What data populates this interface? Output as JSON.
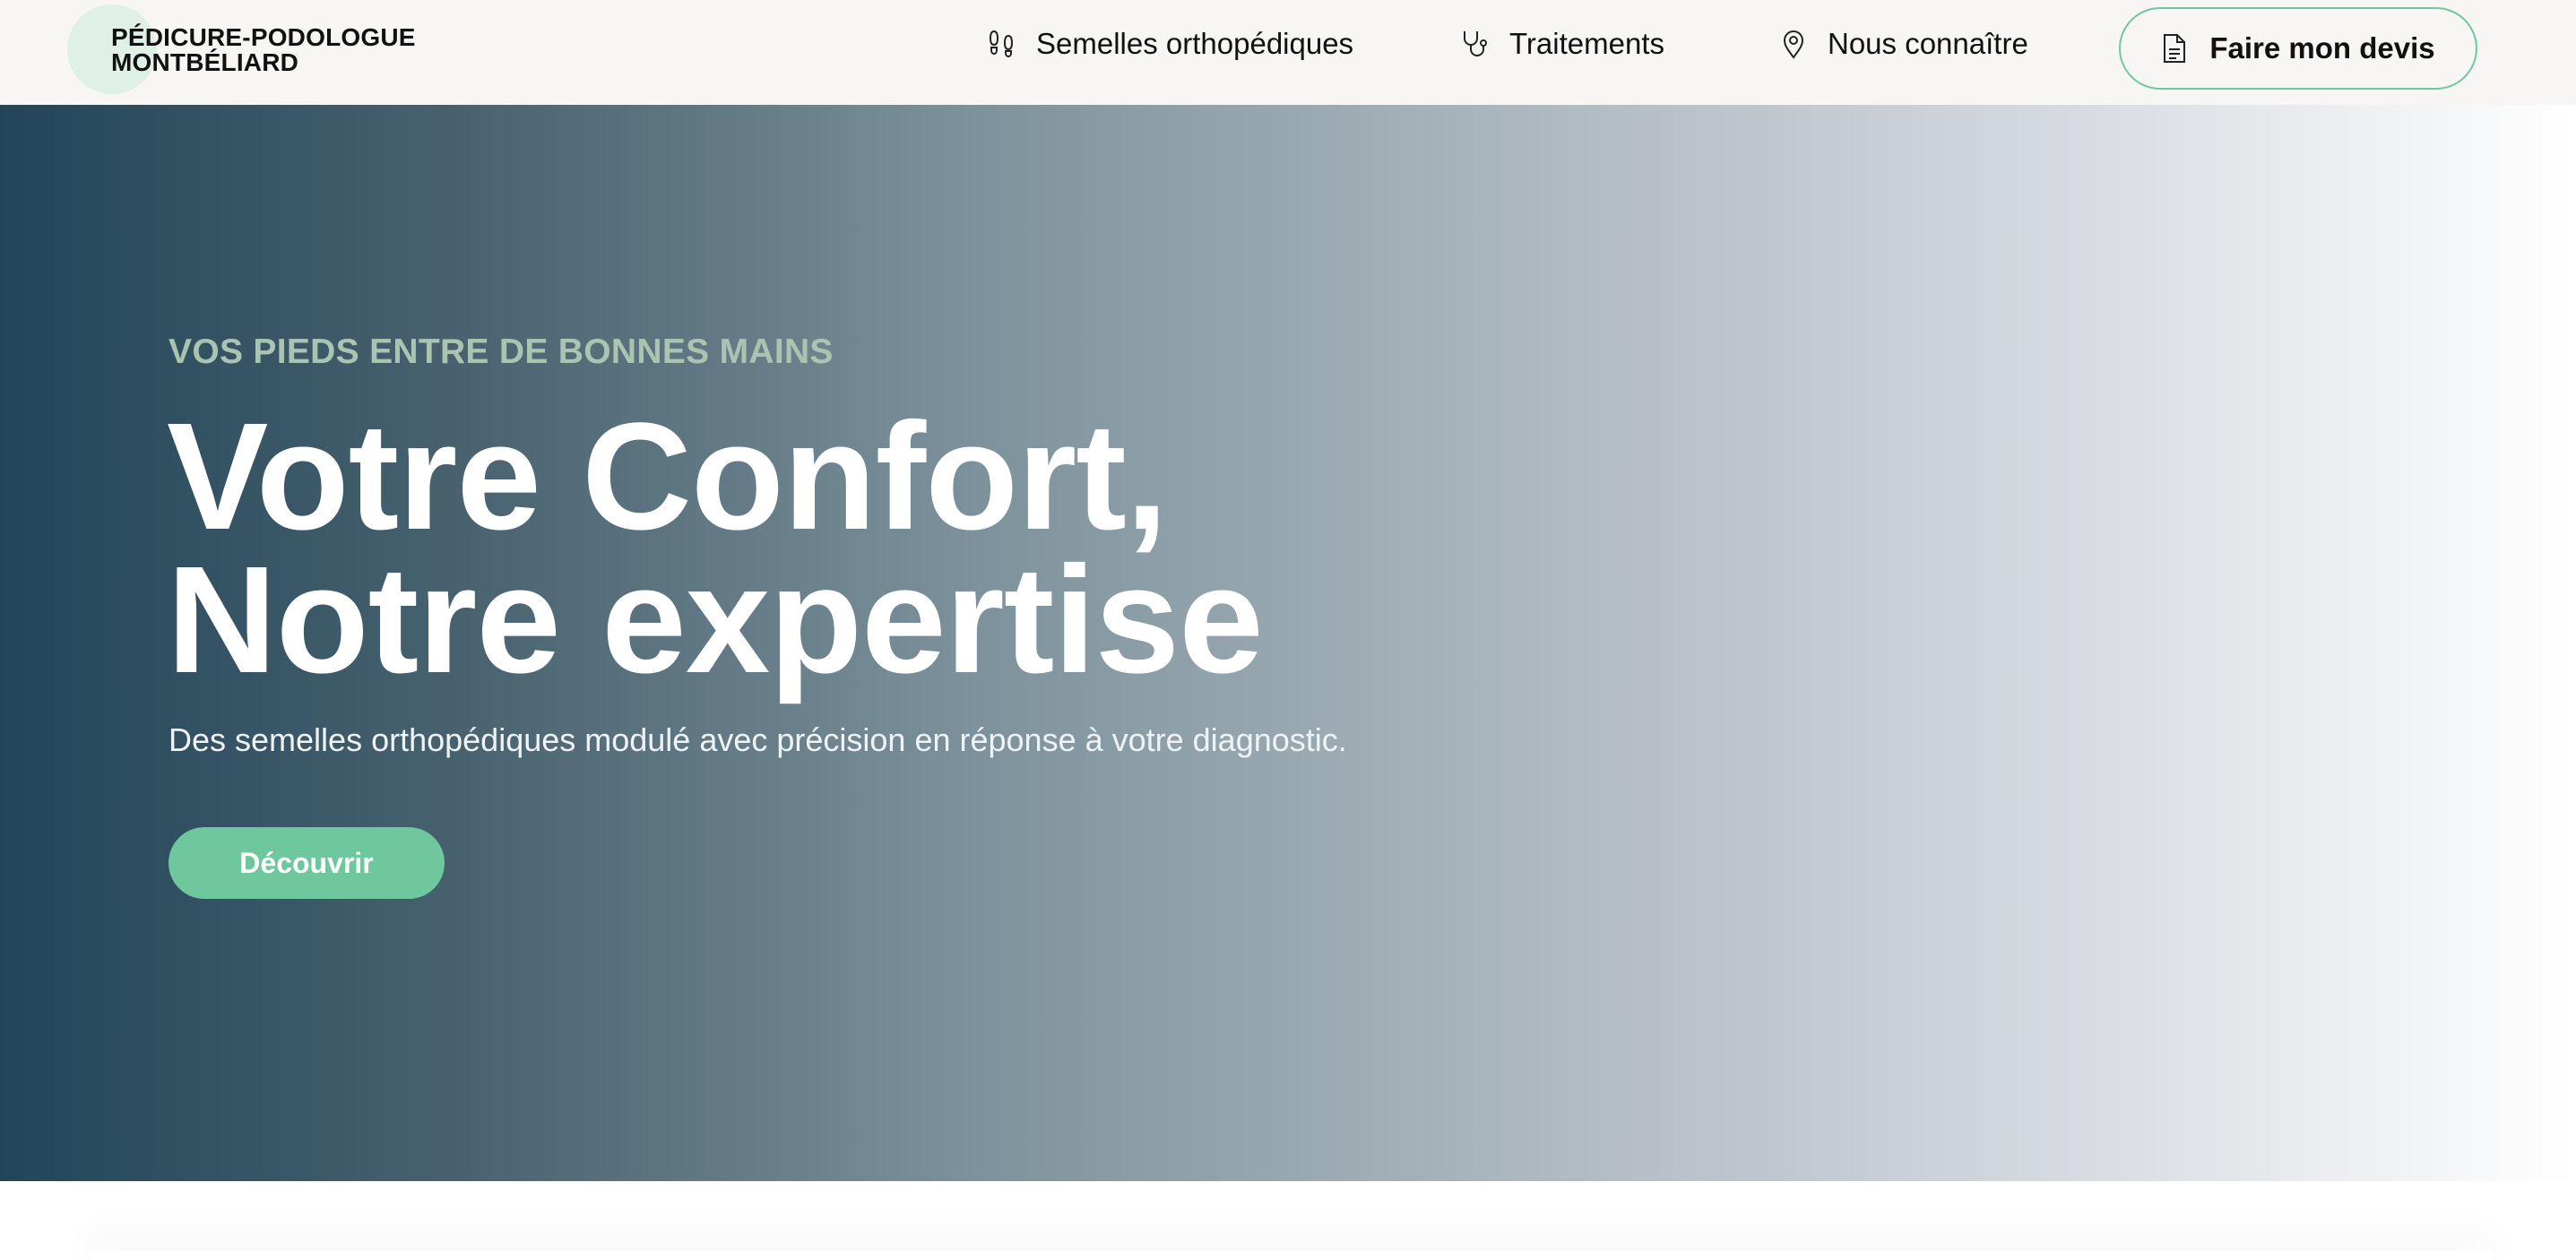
{
  "logo": {
    "line1": "PÉDICURE-PODOLOGUE",
    "line2": "MONTBÉLIARD"
  },
  "nav": {
    "items": [
      {
        "label": "Semelles orthopédiques",
        "icon": "footprints-icon"
      },
      {
        "label": "Traitements",
        "icon": "stethoscope-icon"
      },
      {
        "label": "Nous connaître",
        "icon": "map-pin-icon"
      }
    ],
    "cta": {
      "label": "Faire mon devis",
      "icon": "document-icon"
    }
  },
  "hero": {
    "eyebrow": "VOS PIEDS ENTRE DE BONNES MAINS",
    "headline_line1": "Votre Confort,",
    "headline_line2": "Notre expertise",
    "subtitle": "Des semelles orthopédiques modulé avec précision en réponse à votre diagnostic.",
    "button_label": "Découvrir"
  },
  "colors": {
    "accent": "#6fc79d",
    "hero_dark": "#23455a",
    "eyebrow": "#a9c4b0",
    "header_bg": "#f7f6f4"
  }
}
